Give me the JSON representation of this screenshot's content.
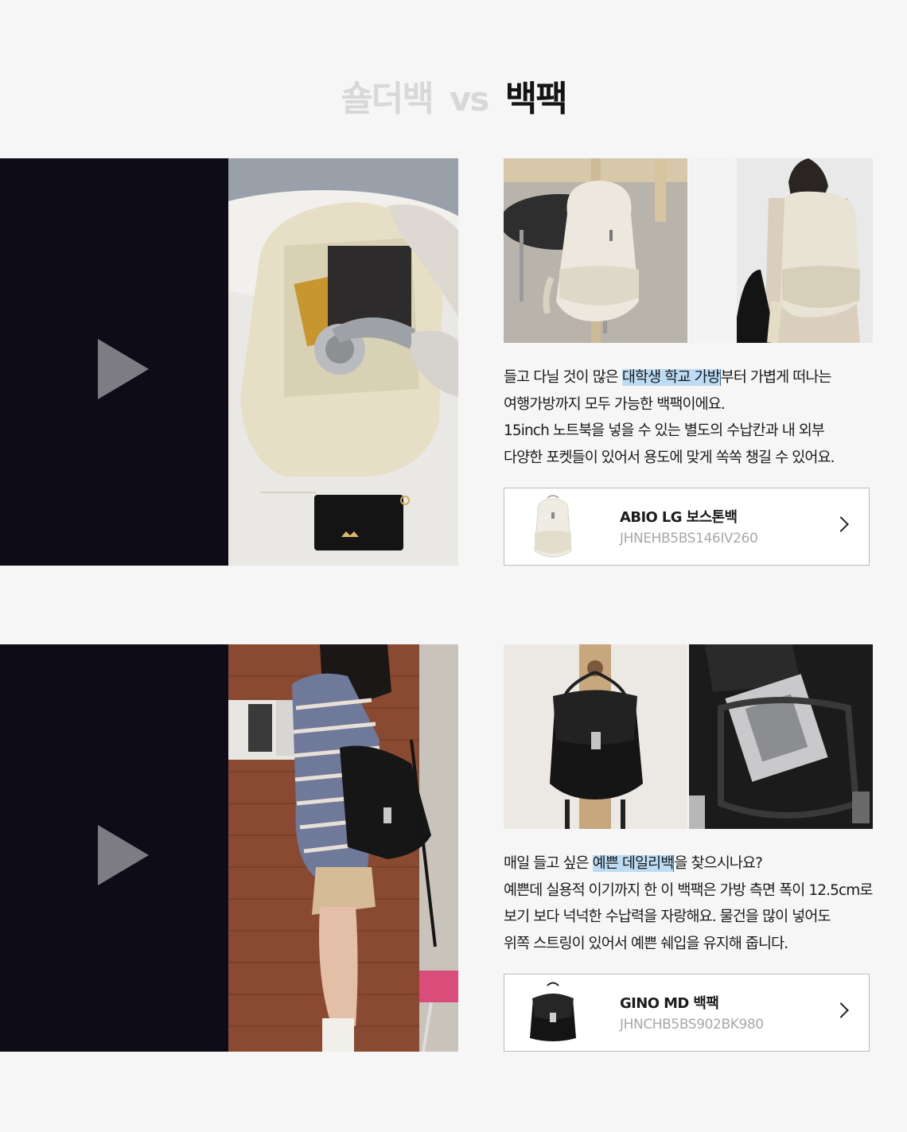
{
  "header": {
    "title_left": "숄더백",
    "title_vs": "vs",
    "title_right": "백팩"
  },
  "sections": [
    {
      "video": {
        "play_icon": "play-icon"
      },
      "description": {
        "line1_before": "들고 다닐 것이 많은 ",
        "line1_highlight": "대학생 학교 가방",
        "line1_after": "부터 가볍게 떠나는",
        "line2": "여행가방까지 모두 가능한 백팩이에요.",
        "line3": "15inch 노트북을 넣을 수 있는 별도의 수납칸과 내 외부",
        "line4": "다양한 포켓들이 있어서 용도에 맞게 쏙쏙 챙길 수 있어요."
      },
      "product": {
        "name": "ABIO LG  보스톤백",
        "code": "JHNEHB5BS146IV260",
        "arrow_icon": "chevron-right-icon"
      }
    },
    {
      "video": {
        "play_icon": "play-icon"
      },
      "description": {
        "line1_before": "매일 들고 싶은 ",
        "line1_highlight": "예쁜 데일리백",
        "line1_after": "을 찾으시나요?",
        "line2": "예쁜데 실용적 이기까지 한 이 백팩은 가방 측면 폭이 12.5cm로",
        "line3": "보기 보다 넉넉한 수납력을 자랑해요. 물건을 많이 넣어도",
        "line4": "위쪽 스트링이 있어서 예쁜 쉐입을 유지해 줍니다."
      },
      "product": {
        "name": "GINO MD 백팩",
        "code": "JHNCHB5BS902BK980",
        "arrow_icon": "chevron-right-icon"
      }
    }
  ],
  "colors": {
    "background": "#f6f6f6",
    "video_dark": "#0e0c16",
    "highlight": "#bcdcf6",
    "title_muted": "#d8d8d8"
  }
}
